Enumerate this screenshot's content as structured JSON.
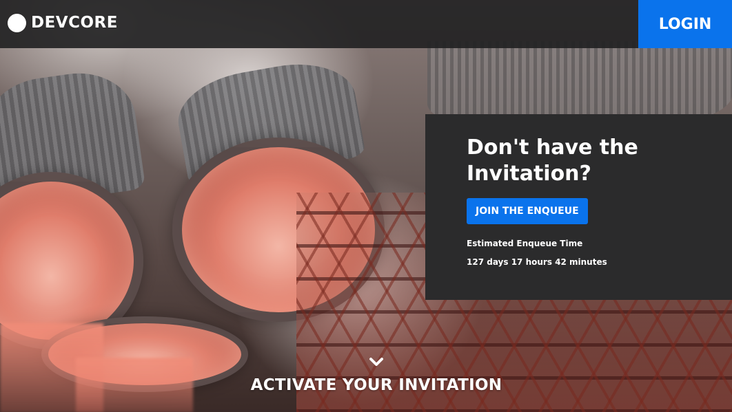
{
  "header": {
    "brand_name": "DEVCORE",
    "login_label": "LOGIN"
  },
  "invite": {
    "title": "Don't have the Invitation?",
    "join_label": "JOIN THE ENQUEUE",
    "estimate_label": "Estimated Enqueue Time",
    "estimate_value": "127 days 17 hours 42 minutes"
  },
  "activate": {
    "label": "ACTIVATE YOUR INVITATION",
    "icon": "chevron-down-icon"
  },
  "colors": {
    "accent": "#0a73ec",
    "header_bg": "#202021",
    "panel_bg": "#2b2b2c",
    "text": "#ffffff"
  }
}
